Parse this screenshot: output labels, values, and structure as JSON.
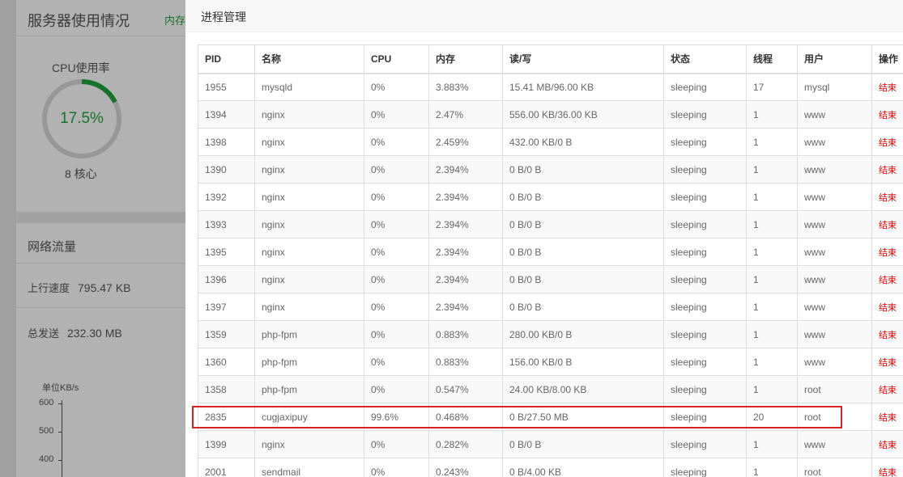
{
  "background": {
    "title": "服务器使用情况",
    "mem_label": "内存",
    "cpu": {
      "label": "CPU使用率",
      "value": "17.5%",
      "percent": 17.5,
      "cores": "8 核心"
    },
    "network": {
      "title": "网络流量",
      "upload_label": "上行速度",
      "upload_value": "795.47 KB",
      "sent_label": "总发送",
      "sent_value": "232.30 MB",
      "chart_unit": "单位KB/s",
      "ticks": [
        "600",
        "500",
        "400"
      ]
    }
  },
  "modal": {
    "title": "进程管理",
    "columns": [
      "PID",
      "名称",
      "CPU",
      "内存",
      "读/写",
      "状态",
      "线程",
      "用户",
      "操作"
    ],
    "action_label": "结束",
    "rows": [
      {
        "pid": "1955",
        "name": "mysqld",
        "cpu": "0%",
        "mem": "3.883%",
        "io": "15.41 MB/96.00 KB",
        "status": "sleeping",
        "threads": "17",
        "user": "mysql"
      },
      {
        "pid": "1394",
        "name": "nginx",
        "cpu": "0%",
        "mem": "2.47%",
        "io": "556.00 KB/36.00 KB",
        "status": "sleeping",
        "threads": "1",
        "user": "www"
      },
      {
        "pid": "1398",
        "name": "nginx",
        "cpu": "0%",
        "mem": "2.459%",
        "io": "432.00 KB/0 B",
        "status": "sleeping",
        "threads": "1",
        "user": "www"
      },
      {
        "pid": "1390",
        "name": "nginx",
        "cpu": "0%",
        "mem": "2.394%",
        "io": "0 B/0 B",
        "status": "sleeping",
        "threads": "1",
        "user": "www"
      },
      {
        "pid": "1392",
        "name": "nginx",
        "cpu": "0%",
        "mem": "2.394%",
        "io": "0 B/0 B",
        "status": "sleeping",
        "threads": "1",
        "user": "www"
      },
      {
        "pid": "1393",
        "name": "nginx",
        "cpu": "0%",
        "mem": "2.394%",
        "io": "0 B/0 B",
        "status": "sleeping",
        "threads": "1",
        "user": "www"
      },
      {
        "pid": "1395",
        "name": "nginx",
        "cpu": "0%",
        "mem": "2.394%",
        "io": "0 B/0 B",
        "status": "sleeping",
        "threads": "1",
        "user": "www"
      },
      {
        "pid": "1396",
        "name": "nginx",
        "cpu": "0%",
        "mem": "2.394%",
        "io": "0 B/0 B",
        "status": "sleeping",
        "threads": "1",
        "user": "www"
      },
      {
        "pid": "1397",
        "name": "nginx",
        "cpu": "0%",
        "mem": "2.394%",
        "io": "0 B/0 B",
        "status": "sleeping",
        "threads": "1",
        "user": "www"
      },
      {
        "pid": "1359",
        "name": "php-fpm",
        "cpu": "0%",
        "mem": "0.883%",
        "io": "280.00 KB/0 B",
        "status": "sleeping",
        "threads": "1",
        "user": "www"
      },
      {
        "pid": "1360",
        "name": "php-fpm",
        "cpu": "0%",
        "mem": "0.883%",
        "io": "156.00 KB/0 B",
        "status": "sleeping",
        "threads": "1",
        "user": "www"
      },
      {
        "pid": "1358",
        "name": "php-fpm",
        "cpu": "0%",
        "mem": "0.547%",
        "io": "24.00 KB/8.00 KB",
        "status": "sleeping",
        "threads": "1",
        "user": "root"
      },
      {
        "pid": "2835",
        "name": "cugjaxipuy",
        "cpu": "99.6%",
        "mem": "0.468%",
        "io": "0 B/27.50 MB",
        "status": "sleeping",
        "threads": "20",
        "user": "root"
      },
      {
        "pid": "1399",
        "name": "nginx",
        "cpu": "0%",
        "mem": "0.282%",
        "io": "0 B/0 B",
        "status": "sleeping",
        "threads": "1",
        "user": "www"
      },
      {
        "pid": "2001",
        "name": "sendmail",
        "cpu": "0%",
        "mem": "0.243%",
        "io": "0 B/4.00 KB",
        "status": "sleeping",
        "threads": "1",
        "user": "root"
      }
    ]
  },
  "colors": {
    "accent_green": "#20a53a",
    "action_red": "#e00000",
    "highlight_red": "#d9211f"
  }
}
